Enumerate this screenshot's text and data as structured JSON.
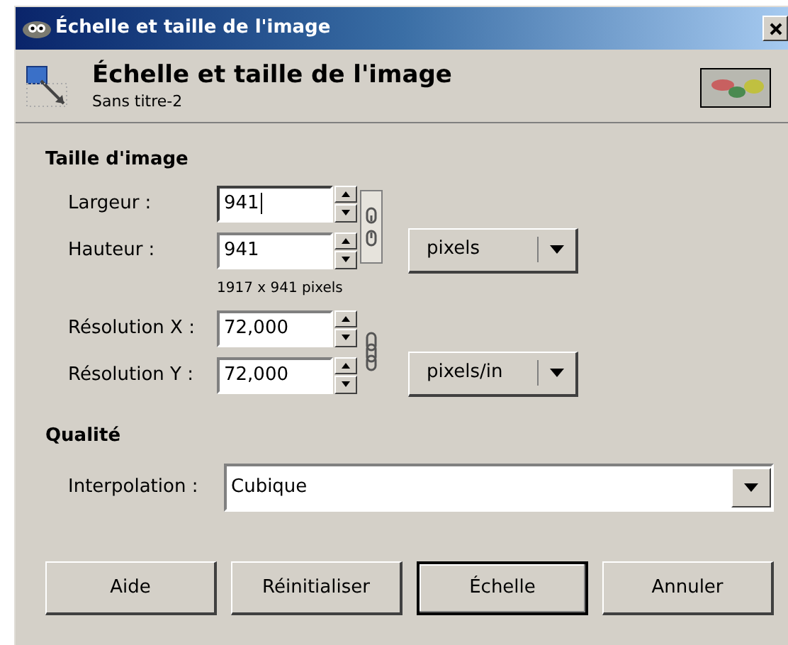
{
  "window": {
    "title": "Échelle et taille de l'image"
  },
  "header": {
    "title": "Échelle et taille de l'image",
    "subtitle": "Sans titre-2"
  },
  "image_size": {
    "heading": "Taille d'image",
    "size_fields": [
      {
        "label": "Largeur :",
        "value": "941",
        "focused": true
      },
      {
        "label": "Hauteur :",
        "value": "941",
        "focused": false
      }
    ],
    "size_chain": {
      "linked": false
    },
    "size_unit": "pixels",
    "caption": "1917 x 941 pixels",
    "resolution_fields": [
      {
        "label": "Résolution X :",
        "value": "72,000",
        "focused": false
      },
      {
        "label": "Résolution Y :",
        "value": "72,000",
        "focused": false
      }
    ],
    "resolution_chain": {
      "linked": true
    },
    "resolution_unit": "pixels/in"
  },
  "quality": {
    "heading": "Qualité",
    "interpolation_label": "Interpolation :",
    "interpolation_value": "Cubique"
  },
  "buttons": [
    {
      "label": "Aide",
      "default": false
    },
    {
      "label": "Réinitialiser",
      "default": false
    },
    {
      "label": "Échelle",
      "default": true
    },
    {
      "label": "Annuler",
      "default": false
    }
  ]
}
